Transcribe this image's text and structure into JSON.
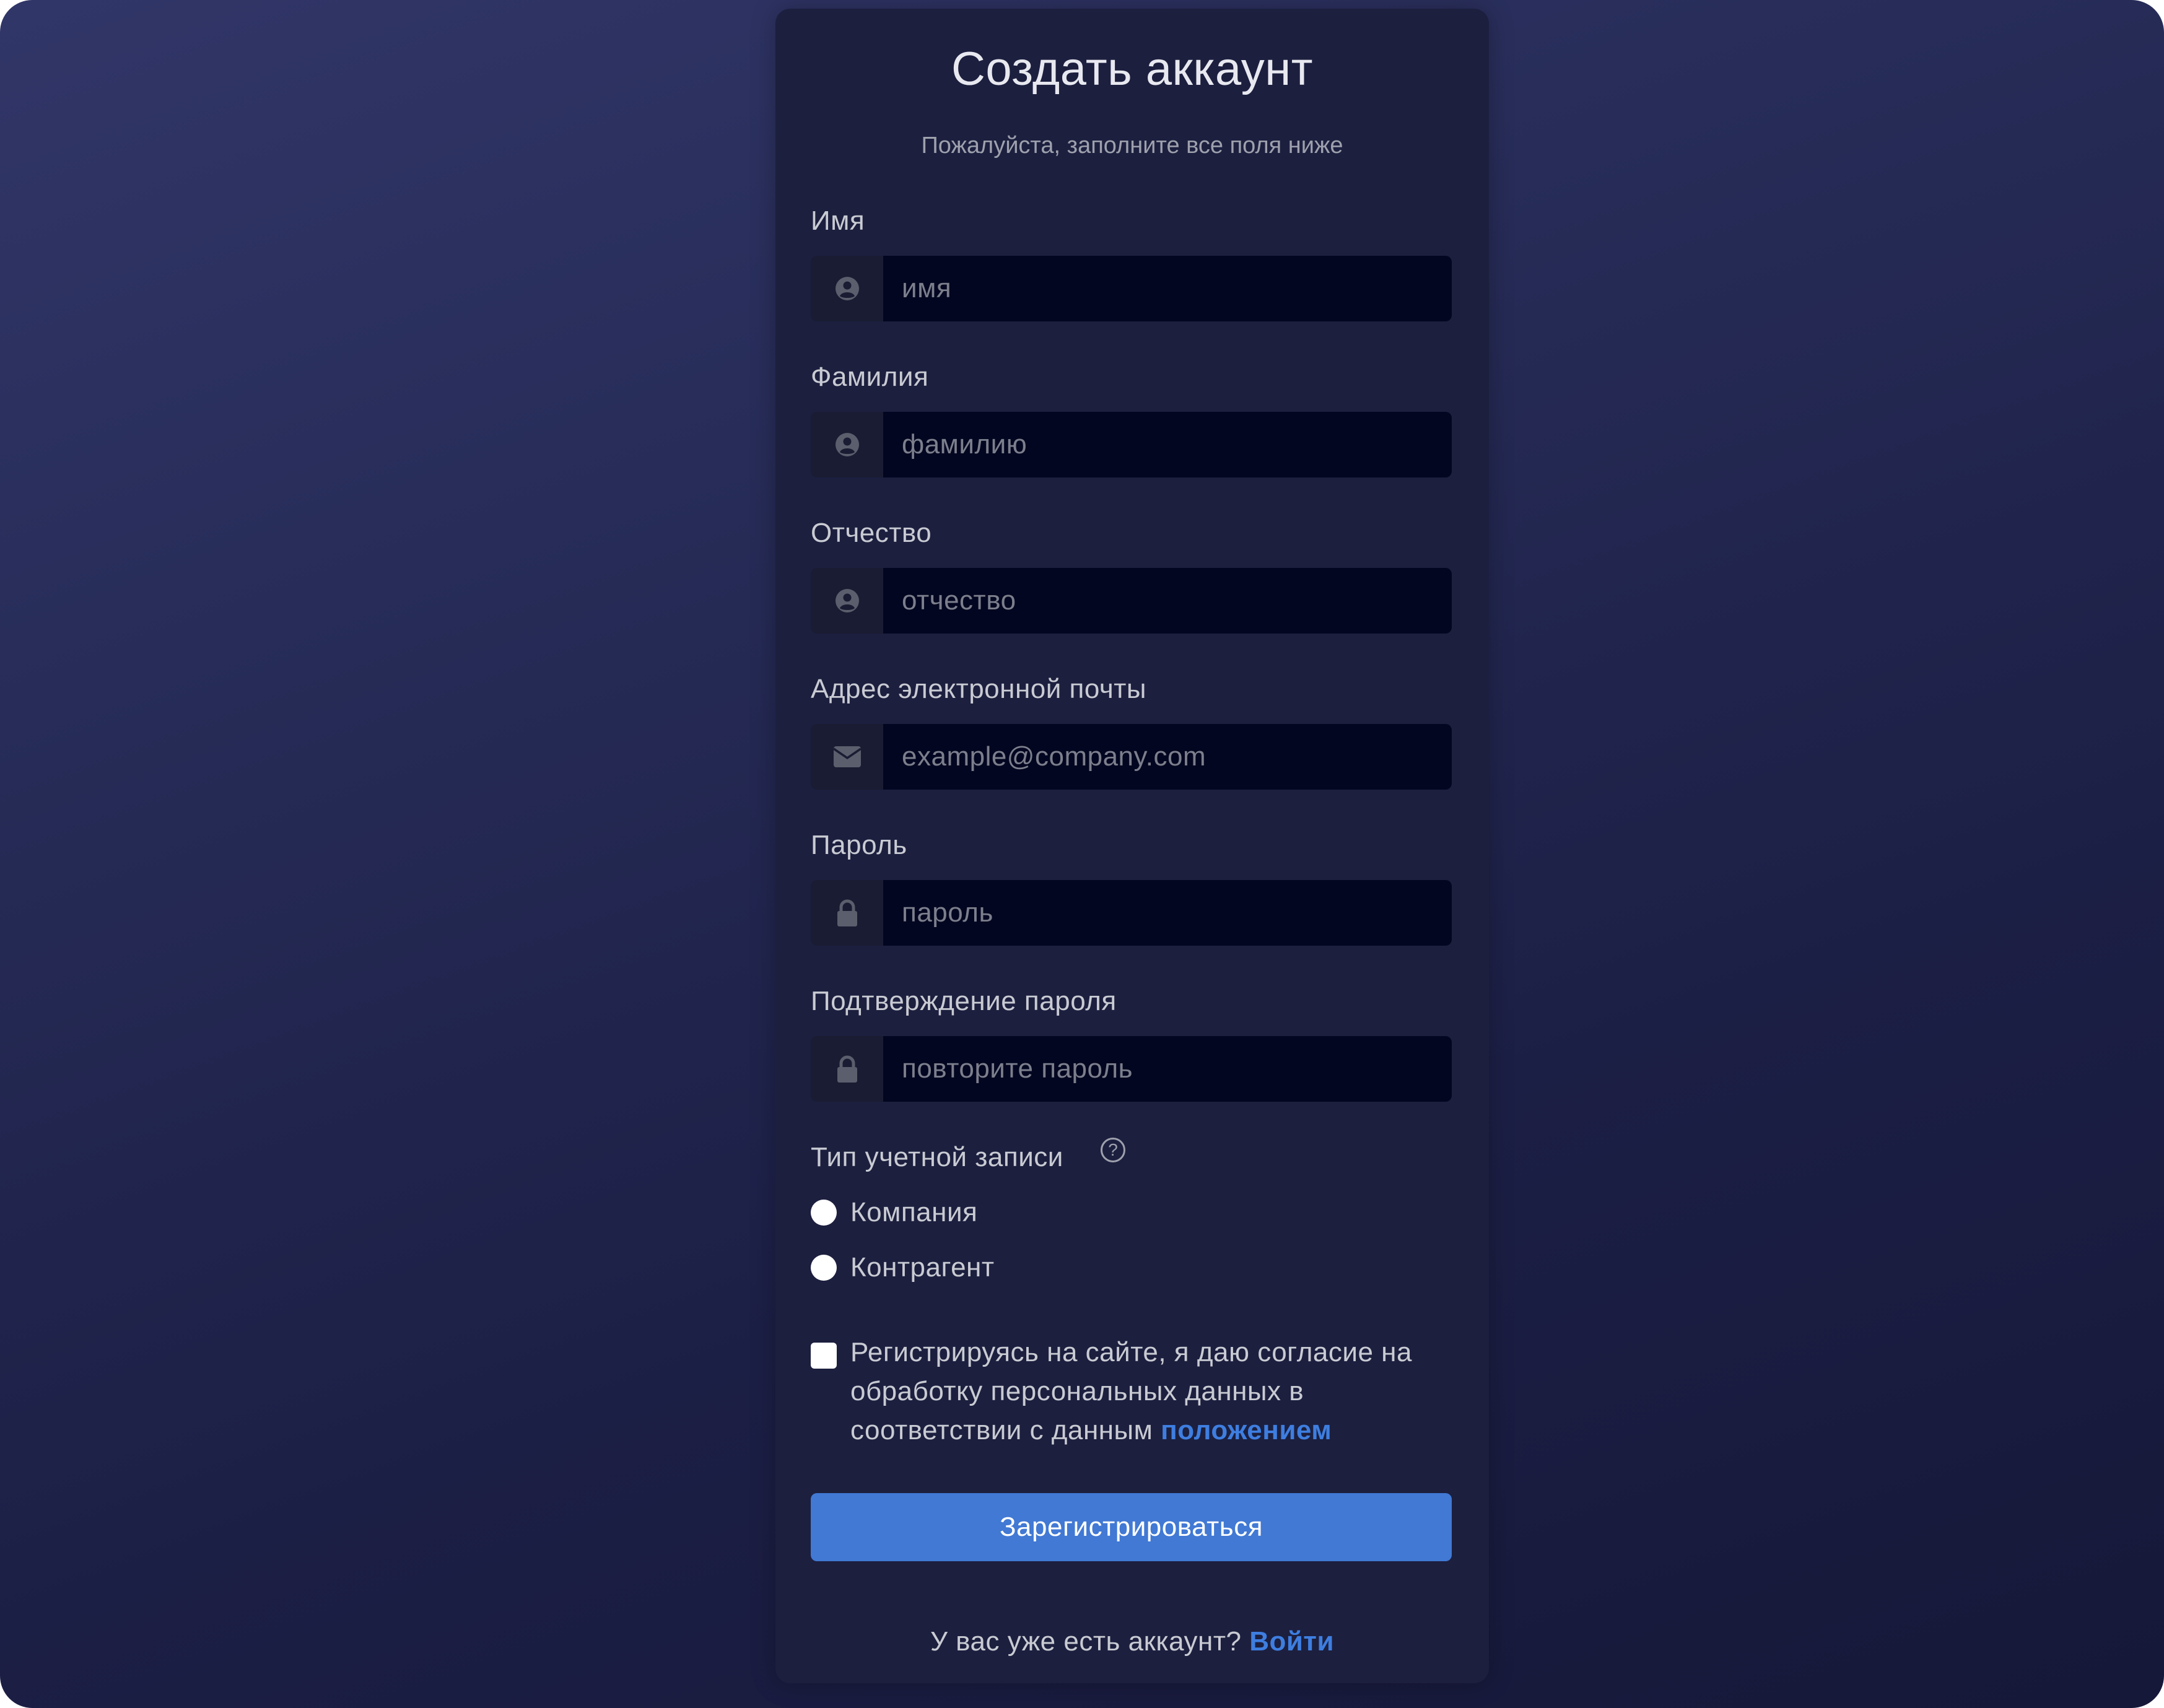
{
  "form": {
    "title": "Создать аккаунт",
    "subtitle": "Пожалуйста, заполните все поля ниже",
    "fields": {
      "first_name": {
        "label": "Имя",
        "placeholder": "имя",
        "icon": "user-circle-icon"
      },
      "last_name": {
        "label": "Фамилия",
        "placeholder": "фамилию",
        "icon": "user-circle-icon"
      },
      "middle_name": {
        "label": "Отчество",
        "placeholder": "отчество",
        "icon": "user-circle-icon"
      },
      "email": {
        "label": "Адрес электронной почты",
        "placeholder": "example@company.com",
        "icon": "envelope-icon"
      },
      "password": {
        "label": "Пароль",
        "placeholder": "пароль",
        "icon": "lock-icon"
      },
      "password_confirm": {
        "label": "Подтверждение пароля",
        "placeholder": "повторите пароль",
        "icon": "lock-icon"
      }
    },
    "account_type": {
      "label": "Тип учетной записи",
      "help_icon": "question-circle-icon",
      "options": [
        "Компания",
        "Контрагент"
      ]
    },
    "consent": {
      "text": "Регистрируясь на сайте, я даю согласие на обработку персональных данных в соответствии с данным",
      "link": "положением"
    },
    "submit_label": "Зарегистрироваться",
    "footer": {
      "text": "У вас уже есть аккаунт?",
      "link": "Войти"
    }
  },
  "colors": {
    "accent": "#4179d4",
    "link": "#3e7ee0",
    "card": "#1c1f3e",
    "input_bg": "#030620"
  }
}
